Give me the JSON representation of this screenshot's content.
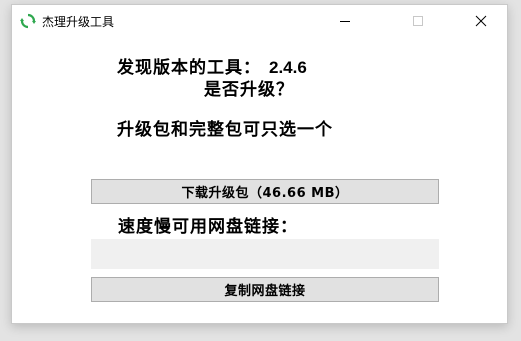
{
  "window": {
    "title": "杰理升级工具",
    "icon": "refresh-icon",
    "controls": {
      "minimize": "minimize-icon",
      "maximize": "maximize-icon",
      "close": "close-icon"
    }
  },
  "main": {
    "found_label": "发现版本的工具：",
    "version": "2.4.6",
    "ask_upgrade": "是否升级？",
    "choose_text": "升级包和完整包可只选一个",
    "download_button_label": "下载升级包（46.66 MB）",
    "speed_label": "速度慢可用网盘链接：",
    "link_value": "",
    "copy_button_label": "复制网盘链接"
  },
  "colors": {
    "icon_green": "#2fa84f",
    "button_bg": "#e1e1e1",
    "button_border": "#adadad",
    "field_bg": "#f0f0f0"
  }
}
